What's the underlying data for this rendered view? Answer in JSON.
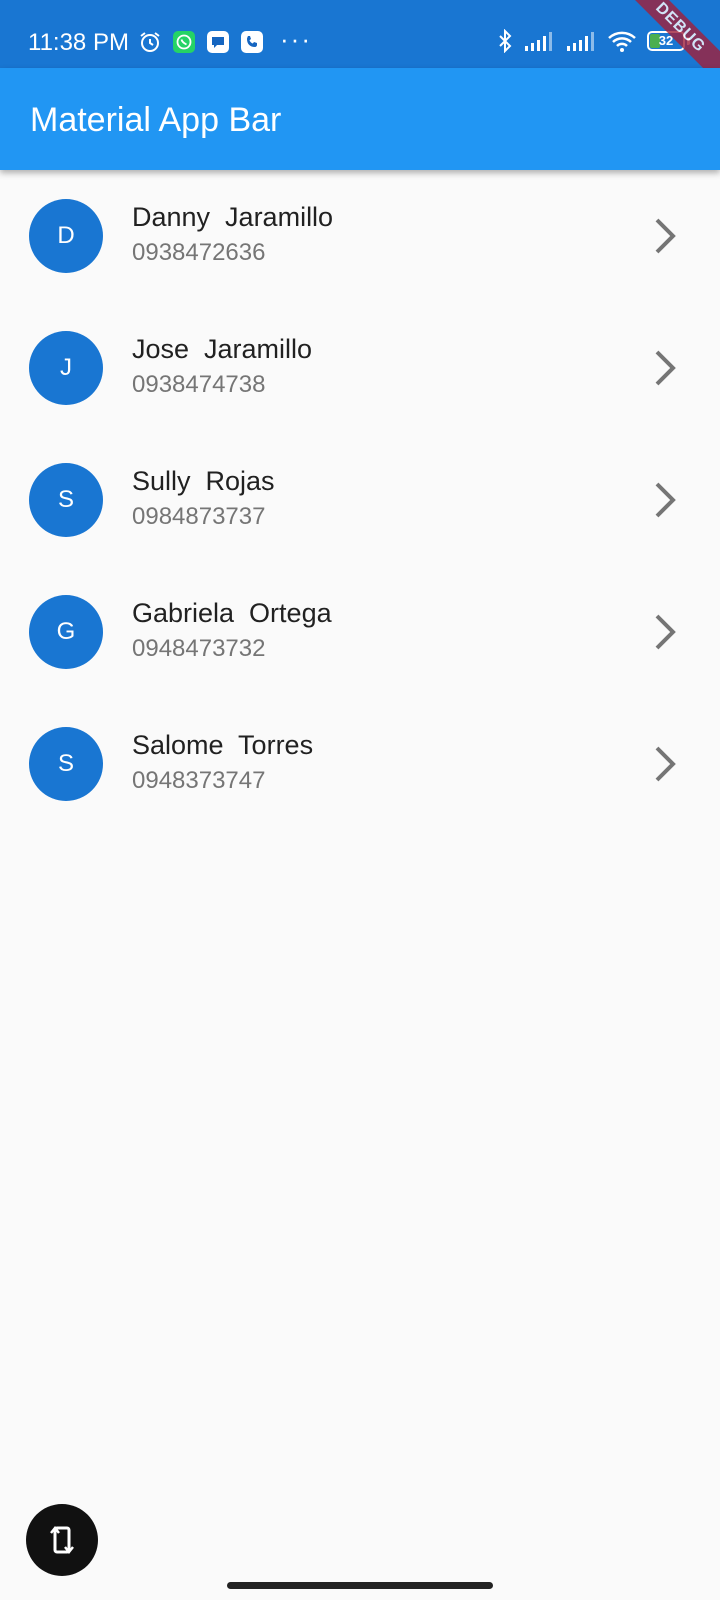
{
  "status_bar": {
    "time": "11:38 PM",
    "battery": {
      "label": "32",
      "level_percent": 32
    },
    "icons": [
      "alarm-icon",
      "whatsapp-icon",
      "message-icon",
      "phone-icon",
      "more-dots-icon",
      "bluetooth-icon",
      "signal-icon",
      "signal-icon",
      "wifi-icon",
      "battery-icon"
    ],
    "more": "···",
    "debug_banner": "DEBUG"
  },
  "app_bar": {
    "title": "Material App Bar"
  },
  "contacts": [
    {
      "initial": "D",
      "name": "Danny  Jaramillo",
      "phone": "0938472636"
    },
    {
      "initial": "J",
      "name": "Jose  Jaramillo",
      "phone": "0938474738"
    },
    {
      "initial": "S",
      "name": "Sully  Rojas",
      "phone": "0984873737"
    },
    {
      "initial": "G",
      "name": "Gabriela  Ortega",
      "phone": "0948473732"
    },
    {
      "initial": "S",
      "name": "Salome  Torres",
      "phone": "0948373747"
    }
  ],
  "fab": {
    "icon": "screen-rotation-icon"
  },
  "colors": {
    "status_bar": "#1976d2",
    "app_bar": "#2196f3",
    "avatar": "#1976d2",
    "background": "#fafafa",
    "fab": "#111111"
  }
}
